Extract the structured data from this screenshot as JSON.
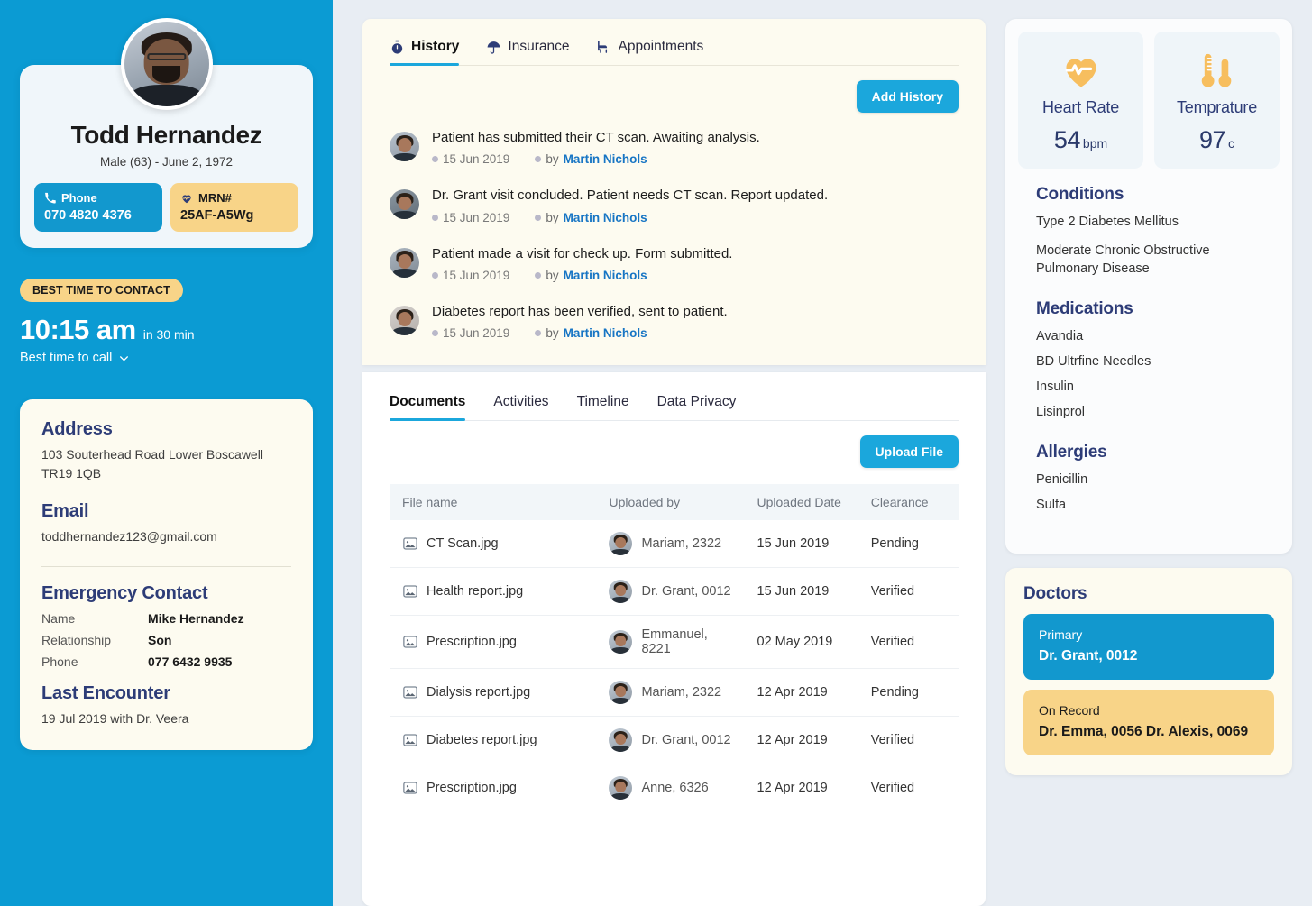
{
  "colors": {
    "sidebar_blue": "#0B9BD3",
    "accent_blue": "#1BA7DC",
    "accent_yellow": "#F8D488",
    "heading_navy": "#2D3C77",
    "page_bg": "#E8EDF3",
    "cream": "#FDFBF0"
  },
  "patient": {
    "name": "Todd Hernandez",
    "meta": "Male (63) - June 2, 1972",
    "phone_label": "Phone",
    "phone_value": "070 4820 4376",
    "mrn_label": "MRN#",
    "mrn_value": "25AF-A5Wg",
    "phone_icon": "phone-handset-icon",
    "mrn_icon": "heart-pulse-icon",
    "avatar_icon": "patient-photo-avatar"
  },
  "contact": {
    "pill": "BEST TIME TO CONTACT",
    "time": "10:15 am",
    "time_sub": "in 30 min",
    "dropdown_label": "Best time to call",
    "chevron_icon": "chevron-down-icon"
  },
  "info": {
    "address_heading": "Address",
    "address_line": "103  Souterhead Road Lower Boscawell TR19 1QB",
    "email_heading": "Email",
    "email_value": "toddhernandez123@gmail.com",
    "emergency_heading": "Emergency Contact",
    "emergency": [
      {
        "key": "Name",
        "value": "Mike Hernandez"
      },
      {
        "key": "Relationship",
        "value": "Son"
      },
      {
        "key": "Phone",
        "value": "077 6432 9935"
      }
    ],
    "last_encounter_heading": "Last Encounter",
    "last_encounter_value": "19 Jul 2019 with Dr. Veera"
  },
  "history_panel": {
    "tabs": [
      {
        "label": "History",
        "icon": "stopwatch-icon",
        "active": true
      },
      {
        "label": "Insurance",
        "icon": "umbrella-icon",
        "active": false
      },
      {
        "label": "Appointments",
        "icon": "exam-chair-icon",
        "active": false
      }
    ],
    "add_button": "Add History",
    "by_prefix": "by",
    "entries": [
      {
        "text": "Patient has submitted their CT scan. Awaiting analysis.",
        "date": "15 Jun 2019",
        "author": "Martin Nichols"
      },
      {
        "text": "Dr. Grant visit concluded. Patient needs CT scan. Report updated.",
        "date": "15 Jun 2019",
        "author": "Martin Nichols"
      },
      {
        "text": "Patient made a visit for check up. Form submitted.",
        "date": "15 Jun 2019",
        "author": "Martin Nichols"
      },
      {
        "text": "Diabetes report has been verified, sent to patient.",
        "date": "15 Jun 2019",
        "author": "Martin Nichols"
      }
    ]
  },
  "docs_panel": {
    "tabs": [
      {
        "label": "Documents",
        "active": true
      },
      {
        "label": "Activities",
        "active": false
      },
      {
        "label": "Timeline",
        "active": false
      },
      {
        "label": "Data Privacy",
        "active": false
      }
    ],
    "upload_button": "Upload  File",
    "columns": [
      "File name",
      "Uploaded by",
      "Uploaded Date",
      "Clearance"
    ],
    "rows": [
      {
        "file": "CT Scan.jpg",
        "by": "Mariam, 2322",
        "date": "15 Jun 2019",
        "clearance": "Pending"
      },
      {
        "file": "Health report.jpg",
        "by": "Dr. Grant, 0012",
        "date": "15 Jun 2019",
        "clearance": "Verified"
      },
      {
        "file": "Prescription.jpg",
        "by": "Emmanuel, 8221",
        "date": "02 May 2019",
        "clearance": "Verified"
      },
      {
        "file": "Dialysis report.jpg",
        "by": "Mariam, 2322",
        "date": "12 Apr 2019",
        "clearance": "Pending"
      },
      {
        "file": "Diabetes report.jpg",
        "by": "Dr. Grant, 0012",
        "date": "12 Apr 2019",
        "clearance": "Verified"
      },
      {
        "file": "Prescription.jpg",
        "by": "Anne, 6326",
        "date": "12 Apr 2019",
        "clearance": "Verified"
      }
    ]
  },
  "vitals": [
    {
      "name": "Heart Rate",
      "value": "54",
      "unit": "bpm",
      "icon": "heart-pulse-icon"
    },
    {
      "name": "Temprature",
      "value": "97",
      "unit": "c",
      "icon": "thermometer-icon"
    }
  ],
  "medical": {
    "conditions_heading": "Conditions",
    "conditions": [
      "Type 2 Diabetes Mellitus",
      "Moderate Chronic Obstructive Pulmonary Disease"
    ],
    "medications_heading": "Medications",
    "medications": [
      "Avandia",
      "BD Ultrfine Needles",
      "Insulin",
      "Lisinprol"
    ],
    "allergies_heading": "Allergies",
    "allergies": [
      "Penicillin",
      "Sulfa"
    ]
  },
  "doctors": {
    "heading": "Doctors",
    "primary_role": "Primary",
    "primary_name": "Dr. Grant, 0012",
    "record_role": "On Record",
    "record_name": "Dr. Emma, 0056 Dr. Alexis, 0069"
  }
}
